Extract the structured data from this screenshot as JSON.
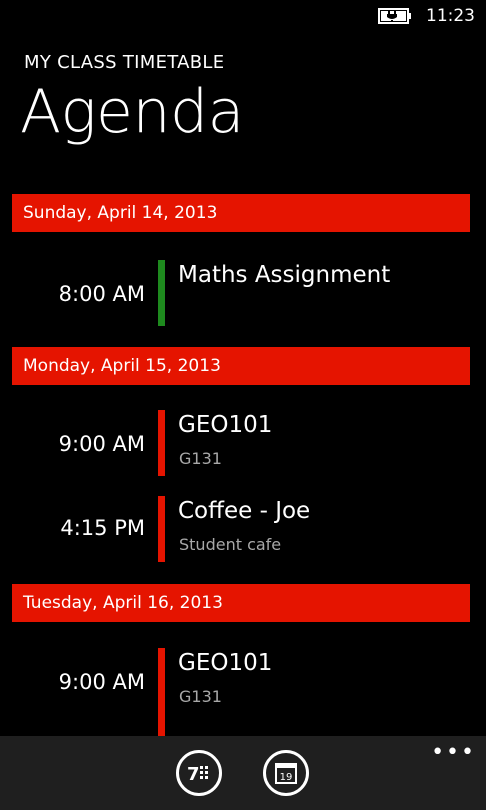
{
  "status_bar": {
    "time": "11:23",
    "battery_icon": "battery-charging-icon"
  },
  "header": {
    "app_title": "MY CLASS TIMETABLE",
    "page_title": "Agenda"
  },
  "colors": {
    "accent": "#e51400",
    "event_green": "#1e8a1e",
    "event_red": "#e51400",
    "app_bar": "#1f1f1f"
  },
  "days": [
    {
      "label": "Sunday, April 14, 2013",
      "events": [
        {
          "time": "8:00 AM",
          "title": "Maths Assignment",
          "subtitle": "",
          "color": "#1e8a1e"
        }
      ]
    },
    {
      "label": "Monday, April 15, 2013",
      "events": [
        {
          "time": "9:00 AM",
          "title": "GEO101",
          "subtitle": "G131",
          "color": "#e51400"
        },
        {
          "time": "4:15 PM",
          "title": "Coffee - Joe",
          "subtitle": "Student cafe",
          "color": "#e51400"
        }
      ]
    },
    {
      "label": "Tuesday, April 16, 2013",
      "events": [
        {
          "time": "9:00 AM",
          "title": "GEO101",
          "subtitle": "G131",
          "color": "#e51400"
        }
      ]
    }
  ],
  "app_bar": {
    "buttons": [
      {
        "icon": "week-view-icon",
        "label": "7"
      },
      {
        "icon": "calendar-icon",
        "label": "19"
      }
    ],
    "more_icon": "more-options-icon"
  }
}
